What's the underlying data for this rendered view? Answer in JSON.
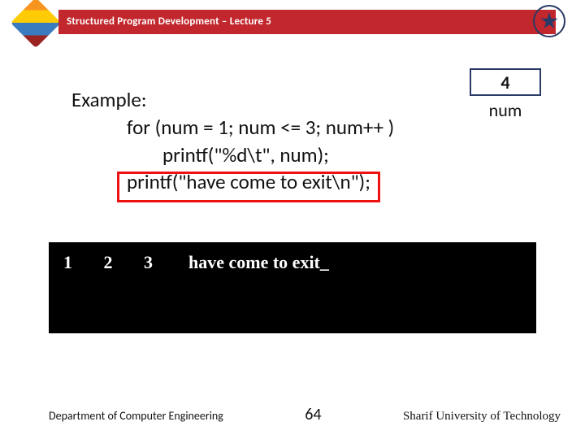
{
  "header": {
    "title": "Structured Program Development – Lecture 5"
  },
  "numbox": {
    "value": "4",
    "label": "num"
  },
  "code": {
    "l1": "Example:",
    "l2": "for (num = 1; num <= 3; num++ )",
    "l3": "printf(\"%d\\t\", num);",
    "l4": "printf(\"have come to exit\\n\");"
  },
  "console": {
    "line1": "1       2       3        have come to exit_"
  },
  "footer": {
    "dept": "Department of Computer Engineering",
    "page": "64",
    "uni": "Sharif University of Technology"
  }
}
